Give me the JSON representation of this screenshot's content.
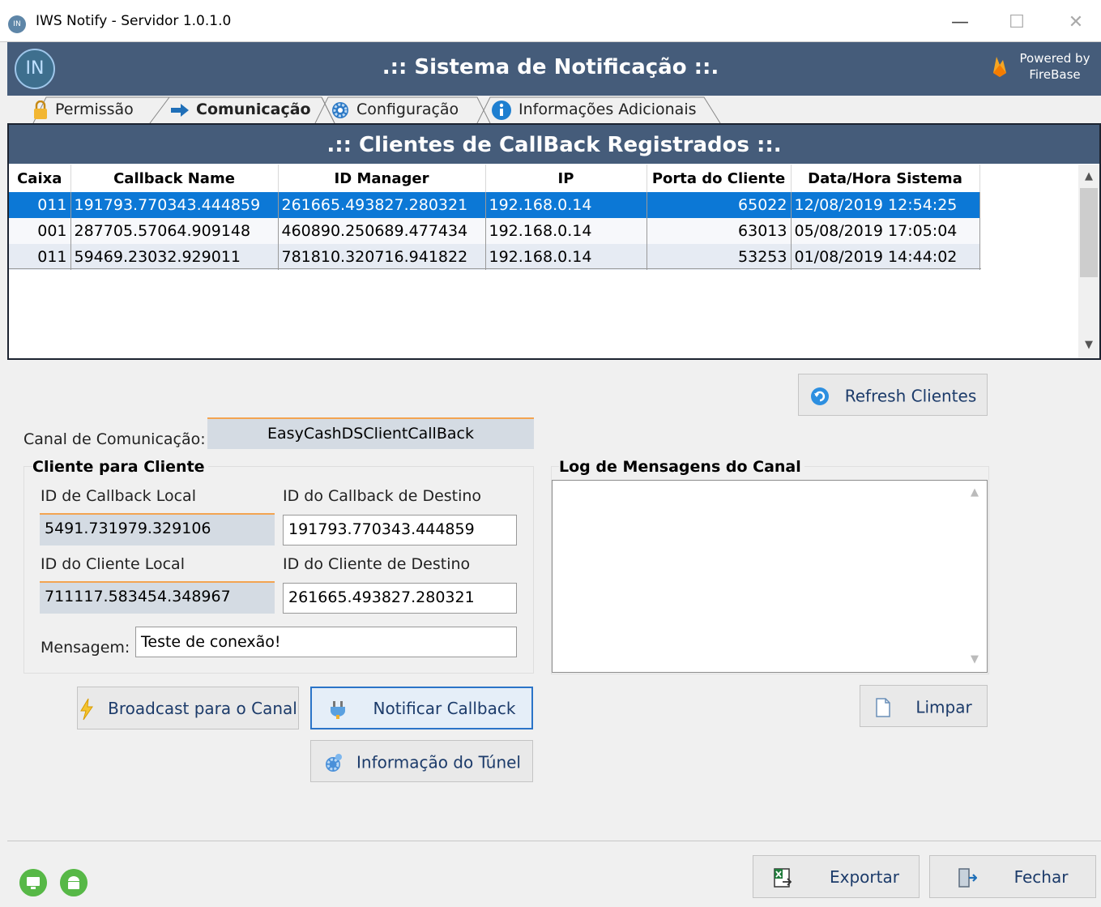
{
  "window": {
    "title": "IWS Notify - Servidor 1.0.1.0",
    "app_icon": "IN",
    "minimize": "—",
    "maximize": "☐",
    "close": "✕"
  },
  "header": {
    "logo": "IN",
    "title": ".:: Sistema de Notificação ::.",
    "powered_by": "Powered by",
    "powered_name": "FireBase"
  },
  "tabs": [
    {
      "label": "Permissão",
      "icon": "lock-icon"
    },
    {
      "label": "Comunicação",
      "icon": "arrow-right-icon"
    },
    {
      "label": "Configuração",
      "icon": "gear-icon"
    },
    {
      "label": "Informações Adicionais",
      "icon": "info-icon"
    }
  ],
  "clients_panel": {
    "title": ".:: Clientes de CallBack Registrados ::.",
    "columns": [
      "Caixa",
      "Callback Name",
      "ID Manager",
      "IP",
      "Porta do Cliente",
      "Data/Hora Sistema"
    ],
    "rows": [
      [
        "011",
        "191793.770343.444859",
        "261665.493827.280321",
        "192.168.0.14",
        "65022",
        "12/08/2019 12:54:25"
      ],
      [
        "001",
        "287705.57064.909148",
        "460890.250689.477434",
        "192.168.0.14",
        "63013",
        "05/08/2019 17:05:04"
      ],
      [
        "011",
        "59469.23032.929011",
        "781810.320716.941822",
        "192.168.0.14",
        "53253",
        "01/08/2019 14:44:02"
      ]
    ]
  },
  "refresh_button": "Refresh Clientes",
  "channel": {
    "label": "Canal de Comunicação:",
    "value": "EasyCashDSClientCallBack"
  },
  "client_to_client": {
    "title": "Cliente para Cliente",
    "local_callback_label": "ID de Callback Local",
    "local_callback_value": "5491.731979.329106",
    "dest_callback_label": "ID do Callback de Destino",
    "dest_callback_value": "191793.770343.444859",
    "local_client_label": "ID do Cliente Local",
    "local_client_value": "711117.583454.348967",
    "dest_client_label": "ID do Cliente de Destino",
    "dest_client_value": "261665.493827.280321",
    "message_label": "Mensagem:",
    "message_value": "Teste de conexão!"
  },
  "log": {
    "title": "Log de Mensagens do Canal",
    "content": ""
  },
  "buttons": {
    "broadcast": "Broadcast para o Canal",
    "notify": "Notificar Callback",
    "tunnel_info": "Informação do Túnel",
    "clear": "Limpar",
    "export": "Exportar",
    "close": "Fechar"
  }
}
